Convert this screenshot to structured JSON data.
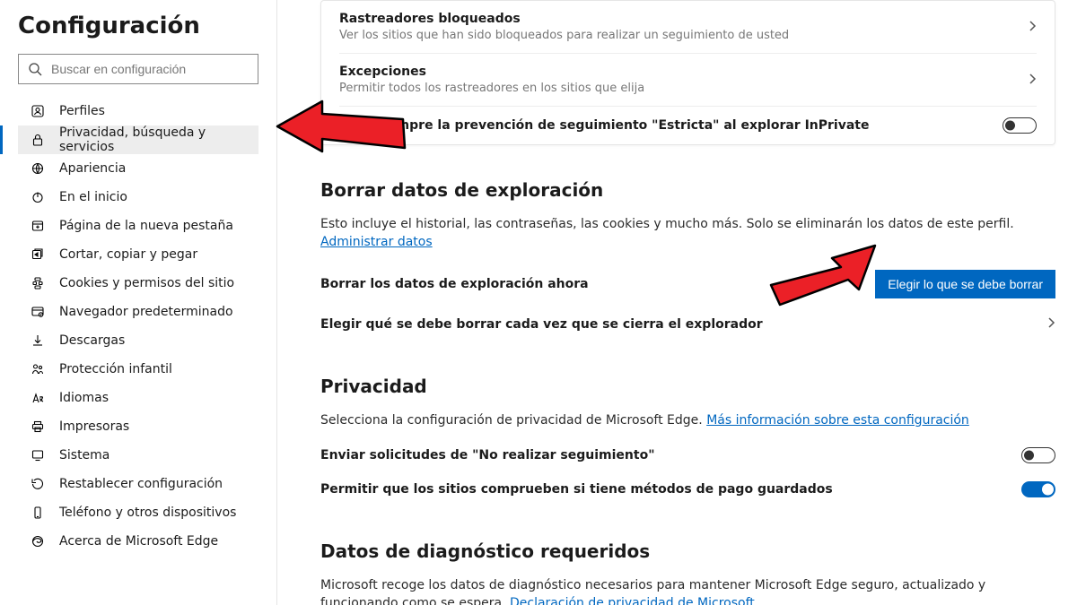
{
  "sidebar": {
    "title": "Configuración",
    "search_placeholder": "Buscar en configuración",
    "items": [
      {
        "label": "Perfiles"
      },
      {
        "label": "Privacidad, búsqueda y servicios"
      },
      {
        "label": "Apariencia"
      },
      {
        "label": "En el inicio"
      },
      {
        "label": "Página de la nueva pestaña"
      },
      {
        "label": "Cortar, copiar y pegar"
      },
      {
        "label": "Cookies y permisos del sitio"
      },
      {
        "label": "Navegador predeterminado"
      },
      {
        "label": "Descargas"
      },
      {
        "label": "Protección infantil"
      },
      {
        "label": "Idiomas"
      },
      {
        "label": "Impresoras"
      },
      {
        "label": "Sistema"
      },
      {
        "label": "Restablecer configuración"
      },
      {
        "label": "Teléfono y otros dispositivos"
      },
      {
        "label": "Acerca de Microsoft Edge"
      }
    ]
  },
  "tracking_card": {
    "rows": [
      {
        "title": "Rastreadores bloqueados",
        "sub": "Ver los sitios que han sido bloqueados para realizar un seguimiento de usted",
        "action": "chevron"
      },
      {
        "title": "Excepciones",
        "sub": "Permitir todos los rastreadores en los sitios que elija",
        "action": "chevron"
      },
      {
        "title": "Usar siempre la prevención de seguimiento \"Estricta\" al explorar InPrivate",
        "sub": "",
        "action": "toggle_off"
      }
    ]
  },
  "clear_data": {
    "heading": "Borrar datos de exploración",
    "desc": "Esto incluye el historial, las contraseñas, las cookies y mucho más. Solo se eliminarán los datos de este perfil. ",
    "link": "Administrar datos",
    "rows": [
      {
        "label": "Borrar los datos de exploración ahora",
        "button": "Elegir lo que se debe borrar"
      },
      {
        "label": "Elegir qué se debe borrar cada vez que se cierra el explorador",
        "action": "chevron"
      }
    ]
  },
  "privacy": {
    "heading": "Privacidad",
    "desc": "Selecciona la configuración de privacidad de Microsoft Edge. ",
    "link": "Más información sobre esta configuración",
    "rows": [
      {
        "label": "Enviar solicitudes de \"No realizar seguimiento\"",
        "toggle": "off"
      },
      {
        "label": "Permitir que los sitios comprueben si tiene métodos de pago guardados",
        "toggle": "on"
      }
    ]
  },
  "diagnostics": {
    "heading": "Datos de diagnóstico requeridos",
    "desc": "Microsoft recoge los datos de diagnóstico necesarios para mantener Microsoft Edge seguro, actualizado y funcionando como se espera. ",
    "link": "Declaración de privacidad de Microsoft"
  }
}
